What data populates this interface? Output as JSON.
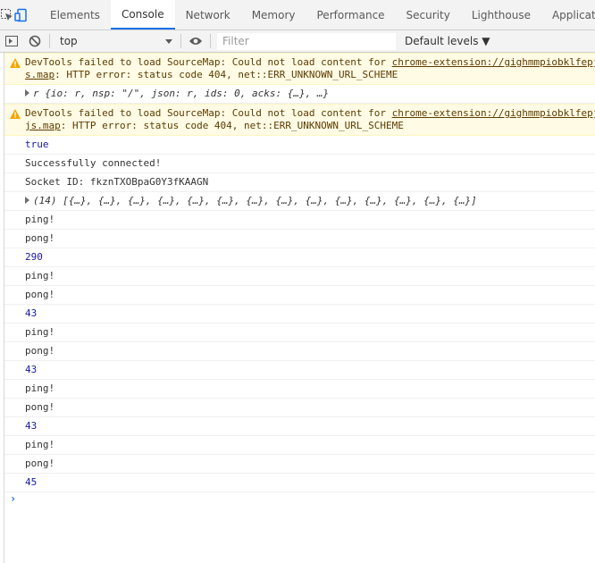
{
  "tabs": [
    "Elements",
    "Console",
    "Network",
    "Memory",
    "Performance",
    "Security",
    "Lighthouse",
    "Application"
  ],
  "toolbar": {
    "context": "top",
    "filter_placeholder": "Filter",
    "levels": "Default levels ▼"
  },
  "console": {
    "warn1_text": "DevTools failed to load SourceMap: Could not load content for ",
    "warn1_link": "chrome-extension://gighmmpiobklfepj",
    "warn1_link2": "s.map",
    "warn1_rest": ": HTTP error: status code 404, net::ERR_UNKNOWN_URL_SCHEME",
    "obj_line": "r {io: r, nsp: \"/\", json: r, ids: 0, acks: {…}, …}",
    "warn2_text": "DevTools failed to load SourceMap: Could not load content for ",
    "warn2_link": "chrome-extension://gighmmpiobklfepj",
    "warn2_link2": "js.map",
    "warn2_rest": ": HTTP error: status code 404, net::ERR_UNKNOWN_URL_SCHEME",
    "true_line": "true",
    "connected": "Successfully connected!",
    "socket_id": "Socket ID: fkznTXOBpaG0Y3fKAAGN",
    "array_line": "(14) [{…}, {…}, {…}, {…}, {…}, {…}, {…}, {…}, {…}, {…}, {…}, {…}, {…}, {…}]",
    "logs": [
      {
        "text": "ping!",
        "kind": "text"
      },
      {
        "text": "pong!",
        "kind": "text"
      },
      {
        "text": "290",
        "kind": "num"
      },
      {
        "text": "ping!",
        "kind": "text"
      },
      {
        "text": "pong!",
        "kind": "text"
      },
      {
        "text": "43",
        "kind": "num"
      },
      {
        "text": "ping!",
        "kind": "text"
      },
      {
        "text": "pong!",
        "kind": "text"
      },
      {
        "text": "43",
        "kind": "num"
      },
      {
        "text": "ping!",
        "kind": "text"
      },
      {
        "text": "pong!",
        "kind": "text"
      },
      {
        "text": "43",
        "kind": "num"
      },
      {
        "text": "ping!",
        "kind": "text"
      },
      {
        "text": "pong!",
        "kind": "text"
      },
      {
        "text": "45",
        "kind": "num"
      }
    ],
    "prompt": "›"
  }
}
